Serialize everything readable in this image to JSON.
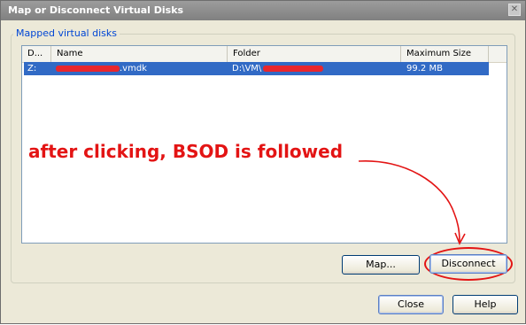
{
  "window": {
    "title": "Map or Disconnect Virtual Disks"
  },
  "icons": {
    "close": "close-icon"
  },
  "group": {
    "label": "Mapped virtual disks"
  },
  "list": {
    "columns": [
      "D...",
      "Name",
      "Folder",
      "Maximum Size"
    ],
    "rows": [
      {
        "drive": "Z:",
        "name": ".vmdk",
        "folder": "D:\\VM\\",
        "max_size": "99.2 MB",
        "selected": true
      }
    ]
  },
  "annotation": {
    "text": "after clicking, BSOD is followed",
    "color": "#e31414"
  },
  "buttons": {
    "map": "Map...",
    "disconnect": "Disconnect",
    "close": "Close",
    "help": "Help"
  },
  "colors": {
    "selection": "#316ac5",
    "accent": "#0046d5",
    "redaction": "#e8262d"
  }
}
